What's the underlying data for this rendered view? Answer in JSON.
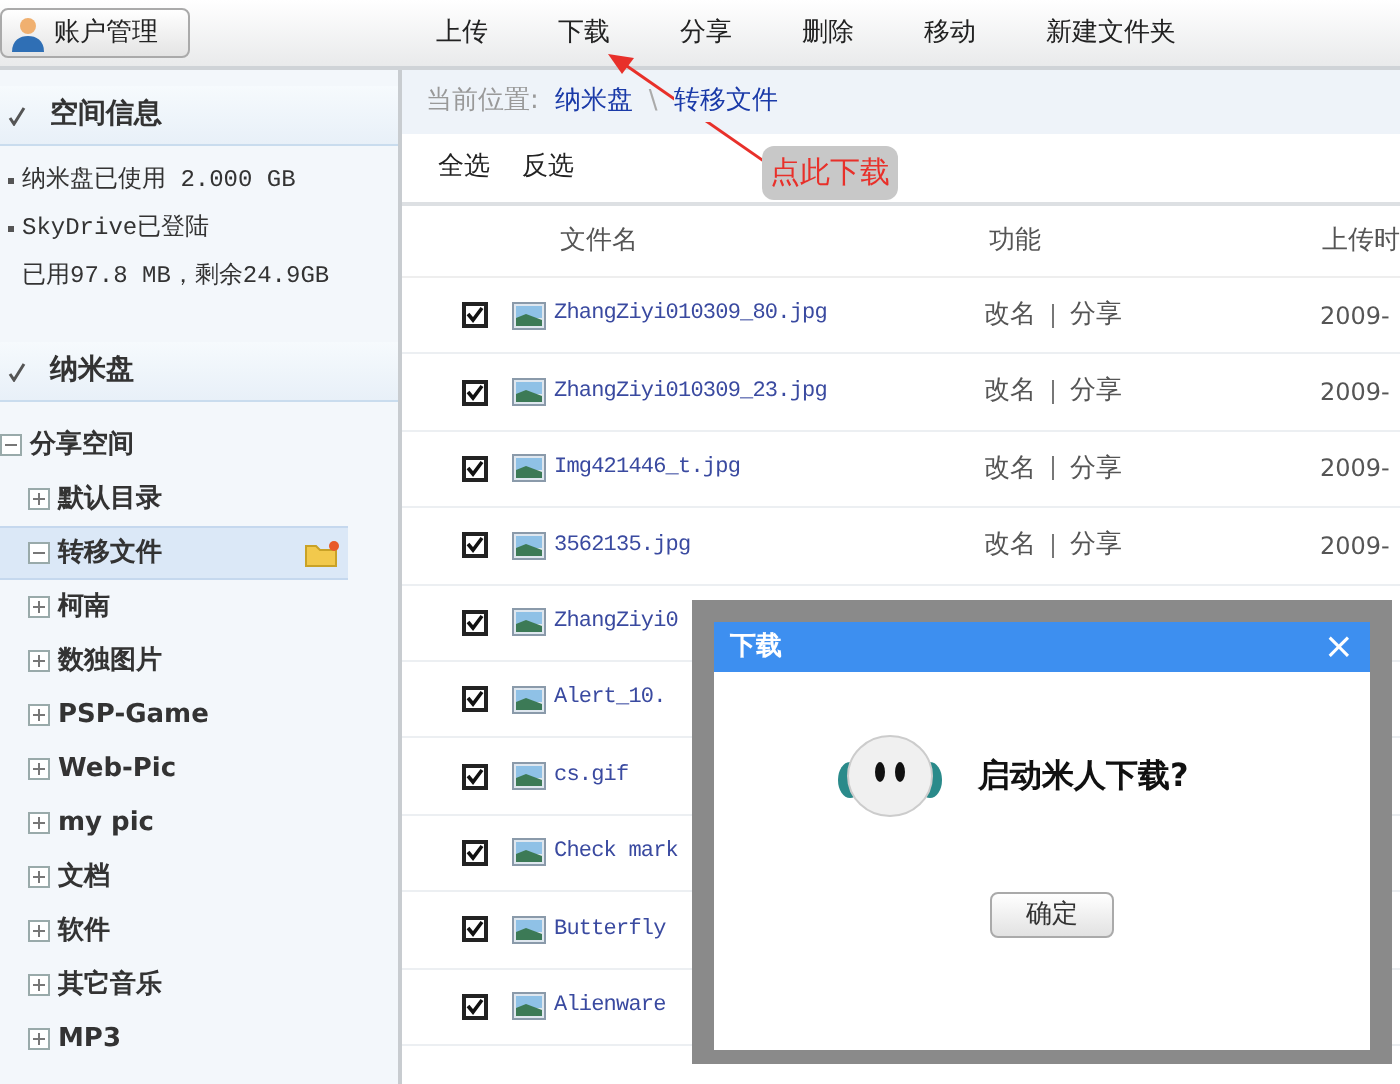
{
  "account_button": {
    "label": "账户管理"
  },
  "toolbar": [
    {
      "label": "上传"
    },
    {
      "label": "下载"
    },
    {
      "label": "分享"
    },
    {
      "label": "删除"
    },
    {
      "label": "移动"
    },
    {
      "label": "新建文件夹"
    }
  ],
  "sidebar": {
    "sections": [
      {
        "title": "空间信息",
        "lines": [
          {
            "text": "纳米盘已使用 2.000 GB",
            "bullet": true
          },
          {
            "text": "SkyDrive已登陆",
            "bullet": true
          },
          {
            "text": "已用97.8 MB，剩余24.9GB",
            "bullet": false
          }
        ]
      },
      {
        "title": "纳米盘"
      }
    ],
    "tree": [
      {
        "label": "分享空间",
        "expanded": true,
        "selected": false,
        "children": [
          {
            "label": "默认目录",
            "expanded": false,
            "selected": false
          },
          {
            "label": "转移文件",
            "expanded": true,
            "selected": true
          },
          {
            "label": "柯南",
            "expanded": false,
            "selected": false
          },
          {
            "label": "数独图片",
            "expanded": false,
            "selected": false
          },
          {
            "label": "PSP-Game",
            "expanded": false,
            "selected": false
          },
          {
            "label": "Web-Pic",
            "expanded": false,
            "selected": false
          },
          {
            "label": "my pic",
            "expanded": false,
            "selected": false
          },
          {
            "label": "文档",
            "expanded": false,
            "selected": false
          },
          {
            "label": "软件",
            "expanded": false,
            "selected": false
          },
          {
            "label": "其它音乐",
            "expanded": false,
            "selected": false
          },
          {
            "label": "MP3",
            "expanded": false,
            "selected": false
          }
        ]
      }
    ]
  },
  "breadcrumb": {
    "label": "当前位置:",
    "items": [
      "纳米盘",
      "转移文件"
    ],
    "separator": "\\"
  },
  "selection_actions": [
    "全选",
    "反选"
  ],
  "table": {
    "columns": [
      "文件名",
      "功能",
      "上传时"
    ],
    "rows": [
      {
        "checked": true,
        "name": "ZhangZiyi010309_80.jpg",
        "actions": [
          "改名",
          "分享"
        ],
        "date": "2009-"
      },
      {
        "checked": true,
        "name": "ZhangZiyi010309_23.jpg",
        "actions": [
          "改名",
          "分享"
        ],
        "date": "2009-"
      },
      {
        "checked": true,
        "name": "Img421446_t.jpg",
        "actions": [
          "改名",
          "分享"
        ],
        "date": "2009-"
      },
      {
        "checked": true,
        "name": "3562135.jpg",
        "actions": [
          "改名",
          "分享"
        ],
        "date": "2009-"
      },
      {
        "checked": true,
        "name": "ZhangZiyi0"
      },
      {
        "checked": true,
        "name": "Alert_10."
      },
      {
        "checked": true,
        "name": "cs.gif"
      },
      {
        "checked": true,
        "name": "Check mark"
      },
      {
        "checked": true,
        "name": "Butterfly"
      },
      {
        "checked": true,
        "name": "Alienware"
      }
    ]
  },
  "annotation": {
    "text": "点此下载"
  },
  "dialog": {
    "title": "下载",
    "message": "启动米人下载?",
    "button": "确定",
    "close": "×"
  }
}
